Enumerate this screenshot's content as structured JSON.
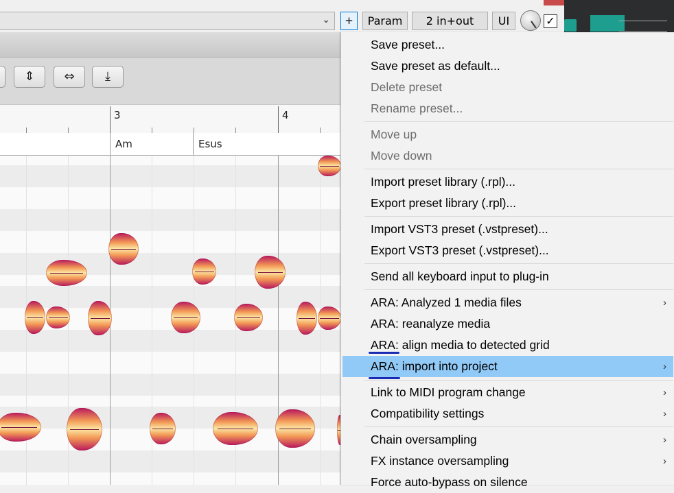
{
  "header": {
    "add_button": "+",
    "param_button": "Param",
    "io_button": "2 in+out",
    "ui_button": "UI",
    "enable_check": "✓"
  },
  "editor": {
    "toolbar_icons": [
      "tool-icon",
      "pitch-align-icon",
      "time-align-icon",
      "compress-icon"
    ],
    "ruler": {
      "bars": [
        "3",
        "4"
      ]
    },
    "chords": [
      "Am",
      "Esus"
    ]
  },
  "menu": {
    "items": [
      {
        "label": "Save preset...",
        "enabled": true,
        "submenu": false
      },
      {
        "label": "Save preset as default...",
        "enabled": true,
        "submenu": false
      },
      {
        "label": "Delete preset",
        "enabled": false,
        "submenu": false
      },
      {
        "label": "Rename preset...",
        "enabled": false,
        "submenu": false
      },
      {
        "label": "Move up",
        "enabled": false,
        "submenu": false
      },
      {
        "label": "Move down",
        "enabled": false,
        "submenu": false
      },
      {
        "label": "Import preset library (.rpl)...",
        "enabled": true,
        "submenu": false
      },
      {
        "label": "Export preset library (.rpl)...",
        "enabled": true,
        "submenu": false
      },
      {
        "label": "Import VST3 preset (.vstpreset)...",
        "enabled": true,
        "submenu": false
      },
      {
        "label": "Export VST3 preset (.vstpreset)...",
        "enabled": true,
        "submenu": false
      },
      {
        "label": "Send all keyboard input to plug-in",
        "enabled": true,
        "submenu": false
      },
      {
        "label": "ARA: Analyzed 1 media files",
        "enabled": true,
        "submenu": true
      },
      {
        "label": "ARA: reanalyze media",
        "enabled": true,
        "submenu": false
      },
      {
        "label": "ARA: align media to detected grid",
        "enabled": true,
        "submenu": false
      },
      {
        "label": "ARA: import into project",
        "enabled": true,
        "submenu": true,
        "highlighted": true
      },
      {
        "label": "Link to MIDI program change",
        "enabled": true,
        "submenu": true
      },
      {
        "label": "Compatibility settings",
        "enabled": true,
        "submenu": true
      },
      {
        "label": "Chain oversampling",
        "enabled": true,
        "submenu": true
      },
      {
        "label": "FX instance oversampling",
        "enabled": true,
        "submenu": true
      },
      {
        "label": "Force auto-bypass on silence",
        "enabled": true,
        "submenu": false
      }
    ],
    "submenu_glyph": "›",
    "highlight_color": "#91c9f7",
    "annotation_color": "#1a2bb5"
  }
}
